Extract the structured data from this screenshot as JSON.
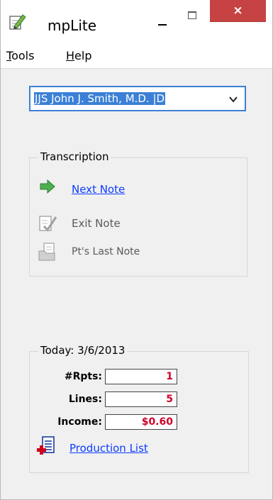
{
  "window": {
    "title": "mpLite",
    "close_glyph": "×"
  },
  "menu": {
    "tools": {
      "accel": "T",
      "rest": "ools"
    },
    "help": {
      "accel": "H",
      "rest": "elp"
    }
  },
  "doctor_select": {
    "value": "JJS  John J. Smith, M.D. |D"
  },
  "transcription": {
    "title": "Transcription",
    "next_note": "Next Note",
    "exit_note": "Exit Note",
    "last_note": "Pt's Last Note"
  },
  "today": {
    "title": "Today: 3/6/2013",
    "rpts_label": "#Rpts:",
    "rpts_value": "1",
    "lines_label": "Lines:",
    "lines_value": "5",
    "income_label": "Income:",
    "income_value": "$0.60",
    "production_list": "Production List"
  },
  "icons": {
    "app": "pencil-note-icon",
    "next": "green-arrow-icon",
    "exit": "exit-note-icon",
    "last": "folder-note-icon",
    "production": "production-list-icon",
    "dropdown": "chevron-down-icon"
  },
  "colors": {
    "accent": "#3b80d6",
    "link": "#0b3cff",
    "value_red": "#d0022a",
    "close_red": "#c74343"
  }
}
